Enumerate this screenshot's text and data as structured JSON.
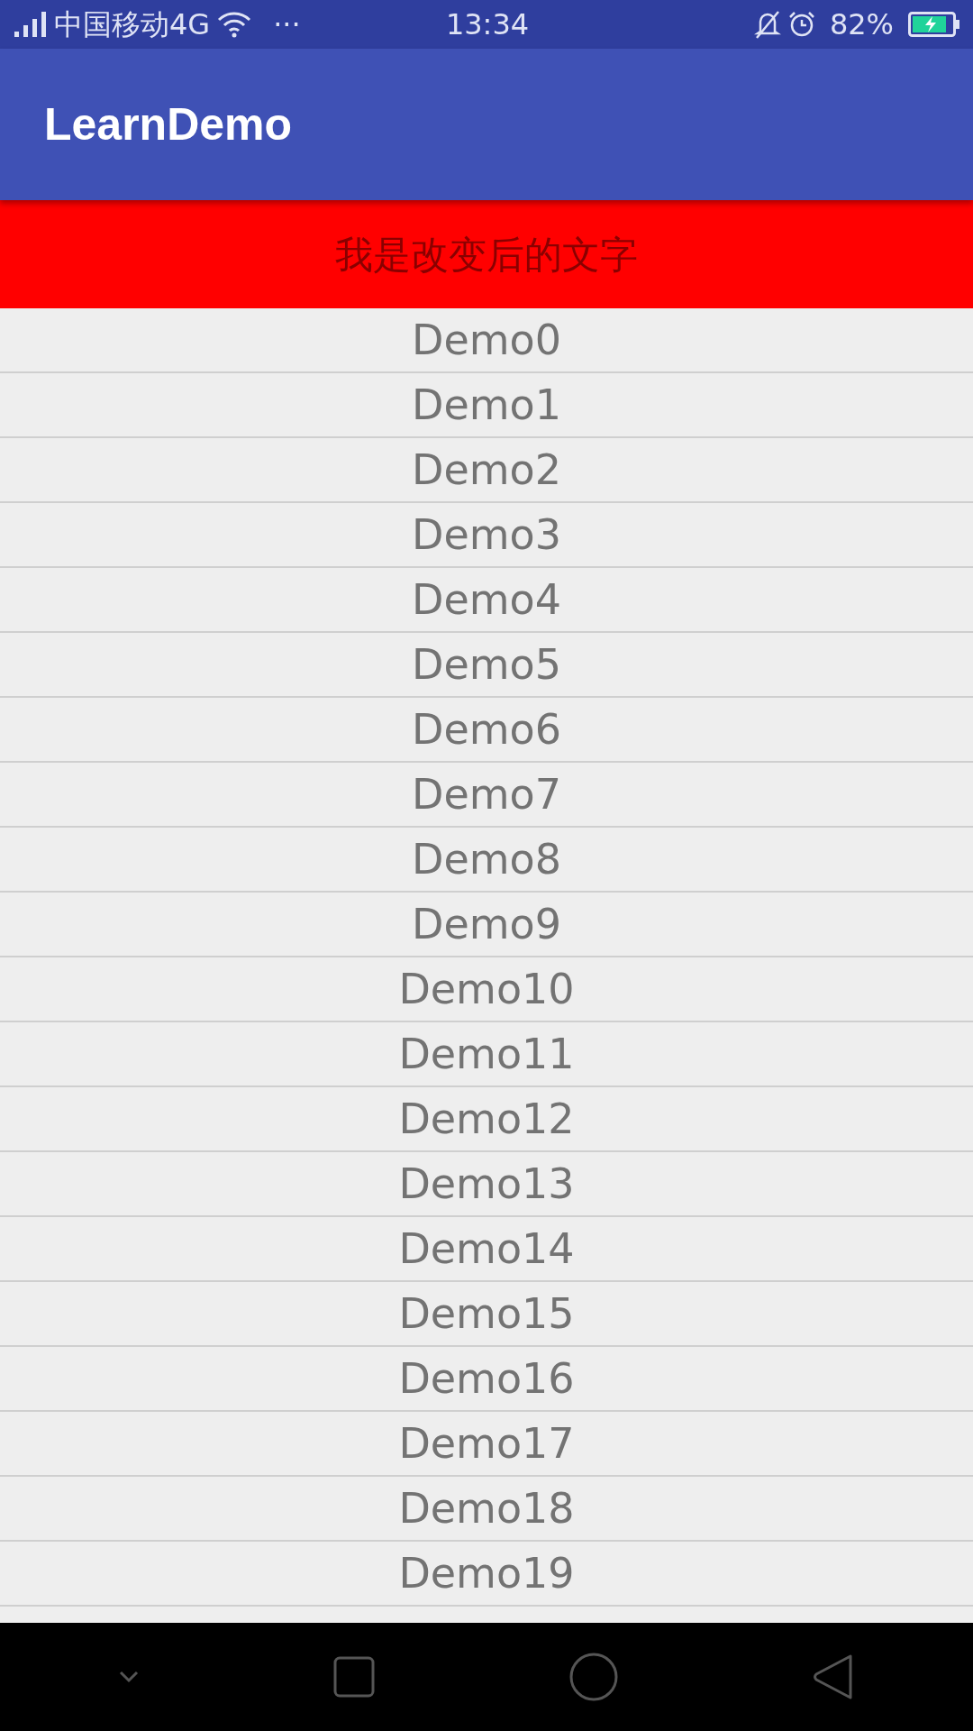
{
  "status_bar": {
    "carrier": "中国移动4G",
    "more": "···",
    "time": "13:34",
    "battery": "82%"
  },
  "app_bar": {
    "title": "LearnDemo"
  },
  "header": {
    "text": "我是改变后的文字"
  },
  "list": {
    "items": [
      {
        "label": "Demo0"
      },
      {
        "label": "Demo1"
      },
      {
        "label": "Demo2"
      },
      {
        "label": "Demo3"
      },
      {
        "label": "Demo4"
      },
      {
        "label": "Demo5"
      },
      {
        "label": "Demo6"
      },
      {
        "label": "Demo7"
      },
      {
        "label": "Demo8"
      },
      {
        "label": "Demo9"
      },
      {
        "label": "Demo10"
      },
      {
        "label": "Demo11"
      },
      {
        "label": "Demo12"
      },
      {
        "label": "Demo13"
      },
      {
        "label": "Demo14"
      },
      {
        "label": "Demo15"
      },
      {
        "label": "Demo16"
      },
      {
        "label": "Demo17"
      },
      {
        "label": "Demo18"
      },
      {
        "label": "Demo19"
      }
    ]
  }
}
